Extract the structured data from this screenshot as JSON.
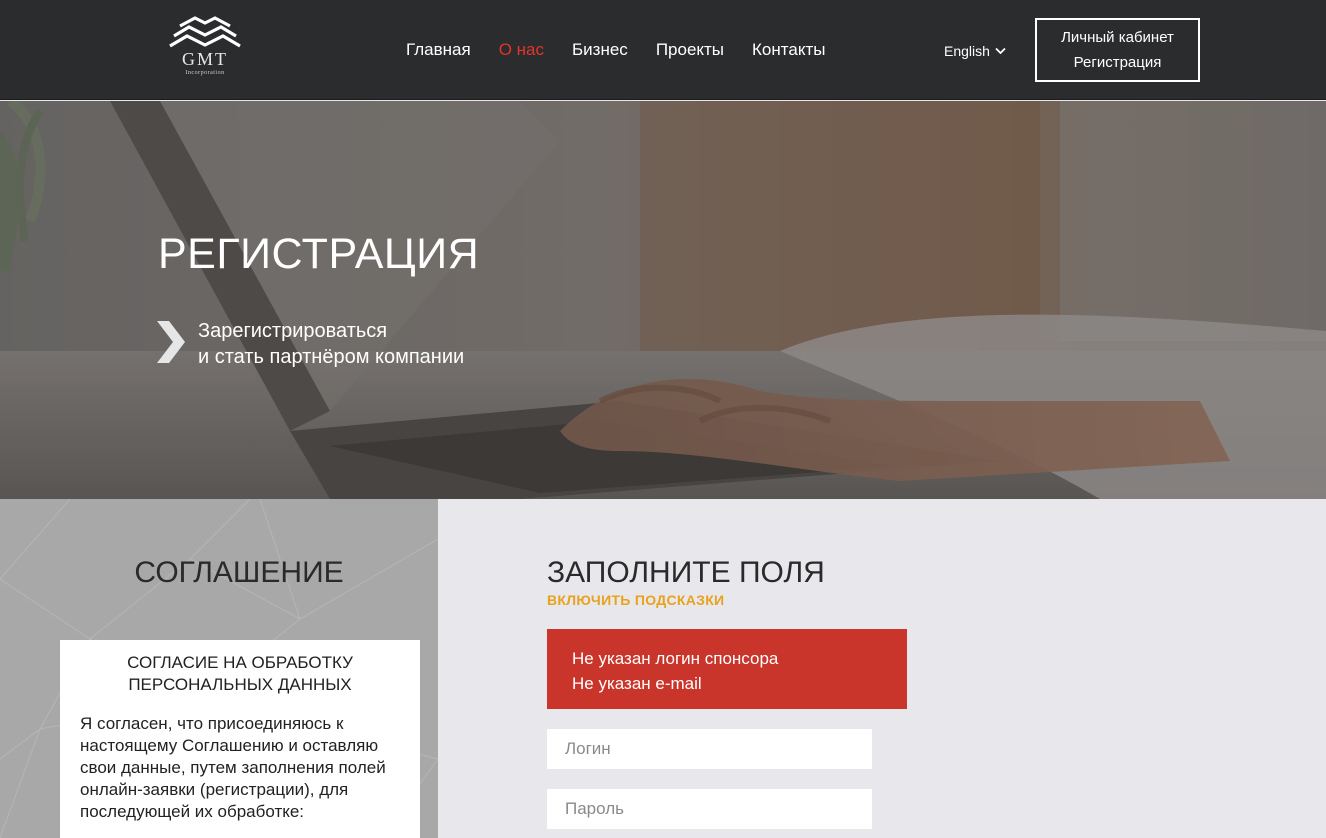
{
  "header": {
    "logo": {
      "text": "GMT",
      "sub": "Incorporation"
    },
    "nav": [
      {
        "label": "Главная",
        "active": false
      },
      {
        "label": "О нас",
        "active": true
      },
      {
        "label": "Бизнес",
        "active": false
      },
      {
        "label": "Проекты",
        "active": false
      },
      {
        "label": "Контакты",
        "active": false
      }
    ],
    "language": "English",
    "account": {
      "cabinet_label": "Личный кабинет",
      "register_label": "Регистрация"
    }
  },
  "hero": {
    "title": "РЕГИСТРАЦИЯ",
    "subtitle_line1": "Зарегистрироваться",
    "subtitle_line2": "и стать партнёром компании"
  },
  "agreement": {
    "title": "СОГЛАШЕНИЕ",
    "card_title": "СОГЛАСИЕ НА ОБРАБОТКУ ПЕРСОНАЛЬНЫХ ДАННЫХ",
    "card_body": "Я согласен, что присоединяюсь к настоящему Соглашению и оставляю свои данные, путем заполнения полей онлайн-заявки (регистрации), для последующей их обработке:"
  },
  "form": {
    "title": "ЗАПОЛНИТЕ ПОЛЯ",
    "hints_label": "ВКЛЮЧИТЬ ПОДСКАЗКИ",
    "errors": [
      "Не указан логин спонсора",
      "Не указан e-mail"
    ],
    "login": {
      "value": "",
      "placeholder": "Логин"
    },
    "password": {
      "value": "",
      "placeholder": "Пароль"
    }
  },
  "colors": {
    "header_bg": "#2b2c2e",
    "active_nav": "#e0352b",
    "hint_orange": "#e8a21b",
    "error_red": "#c9352a",
    "form_bg": "#e8e8ec",
    "agreement_bg": "#a8a8a8"
  },
  "icons": {
    "language_dropdown": "chevron-down-icon",
    "hero_bullet": "chevron-right-icon",
    "logo": "mountain-logo-icon"
  }
}
